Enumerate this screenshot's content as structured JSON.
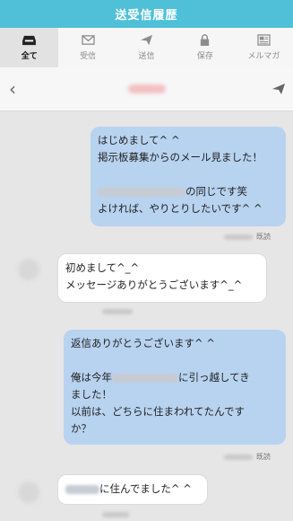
{
  "app": {
    "title": "送受信履歴"
  },
  "tabs": [
    {
      "label": "全て",
      "icon": "inbox-icon"
    },
    {
      "label": "受信",
      "icon": "envelope-icon"
    },
    {
      "label": "送信",
      "icon": "send-icon"
    },
    {
      "label": "保存",
      "icon": "lock-icon"
    },
    {
      "label": "メルマガ",
      "icon": "newspaper-icon"
    }
  ],
  "conversation": {
    "back_icon": "chevron-left-icon",
    "send_icon": "send-icon"
  },
  "messages": [
    {
      "lines": [
        "はじめまして^ ^",
        "掲示板募集からのメール見ました！",
        "",
        "の同じです笑",
        "よければ、やりとりしたいです^ ^"
      ],
      "status": "既読"
    },
    {
      "lines": [
        "初めまして^_^",
        "メッセージありがとうございます^_^"
      ]
    },
    {
      "lines": [
        "返信ありがとうございます^ ^",
        "",
        "俺は今年",
        "に引っ越してき",
        "ました！",
        "以前は、どちらに住まわれてたんです",
        "か？"
      ],
      "status": "既読"
    },
    {
      "lines": [
        "に住んでました^ ^"
      ]
    }
  ],
  "colors": {
    "header": "#4fc0d7",
    "sent_bubble": "#b8d3f0",
    "received_bubble": "#ffffff",
    "background": "#e6e6e6"
  }
}
